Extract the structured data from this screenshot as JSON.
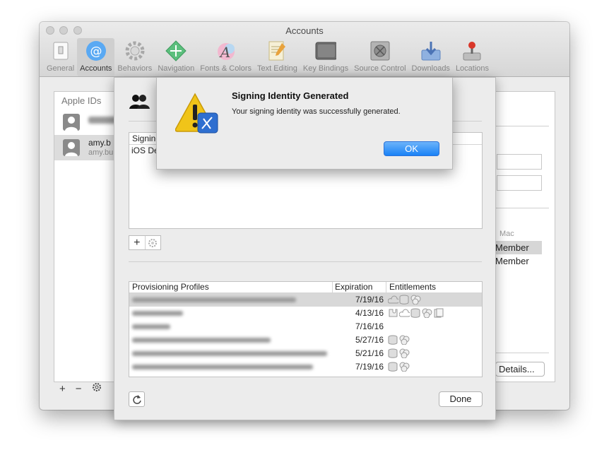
{
  "window": {
    "title": "Accounts"
  },
  "toolbar": {
    "items": [
      {
        "label": "General",
        "icon": "general-icon"
      },
      {
        "label": "Accounts",
        "icon": "at-sign-icon",
        "active": true
      },
      {
        "label": "Behaviors",
        "icon": "gear-icon"
      },
      {
        "label": "Navigation",
        "icon": "navigation-icon"
      },
      {
        "label": "Fonts & Colors",
        "icon": "font-icon"
      },
      {
        "label": "Text Editing",
        "icon": "text-editing-icon"
      },
      {
        "label": "Key Bindings",
        "icon": "keyboard-icon"
      },
      {
        "label": "Source Control",
        "icon": "source-control-icon"
      },
      {
        "label": "Downloads",
        "icon": "downloads-icon"
      },
      {
        "label": "Locations",
        "icon": "joystick-icon"
      }
    ]
  },
  "accounts": {
    "header": "Apple IDs",
    "items": [
      {
        "name": "",
        "email": ""
      },
      {
        "name": "amy.b",
        "email": "amy.bu"
      }
    ]
  },
  "details_panel": {
    "platform_header": "Mac",
    "roles": [
      "Member",
      "Member"
    ],
    "details_label": "Details..."
  },
  "sheet": {
    "signing": {
      "column_header": "Signing",
      "rows": [
        "iOS De"
      ]
    },
    "profiles": {
      "headers": {
        "name": "Provisioning Profiles",
        "expiration": "Expiration",
        "entitlements": "Entitlements"
      },
      "rows": [
        {
          "expiration": "7/19/16"
        },
        {
          "expiration": "4/13/16"
        },
        {
          "expiration": "7/16/16"
        },
        {
          "expiration": "5/27/16"
        },
        {
          "expiration": "5/21/16"
        },
        {
          "expiration": "7/19/16"
        }
      ]
    },
    "done_label": "Done"
  },
  "alert": {
    "title": "Signing Identity Generated",
    "message": "Your signing identity was successfully generated.",
    "ok_label": "OK"
  },
  "colors": {
    "accent": "#1a82f6",
    "warning": "#f0c419"
  }
}
